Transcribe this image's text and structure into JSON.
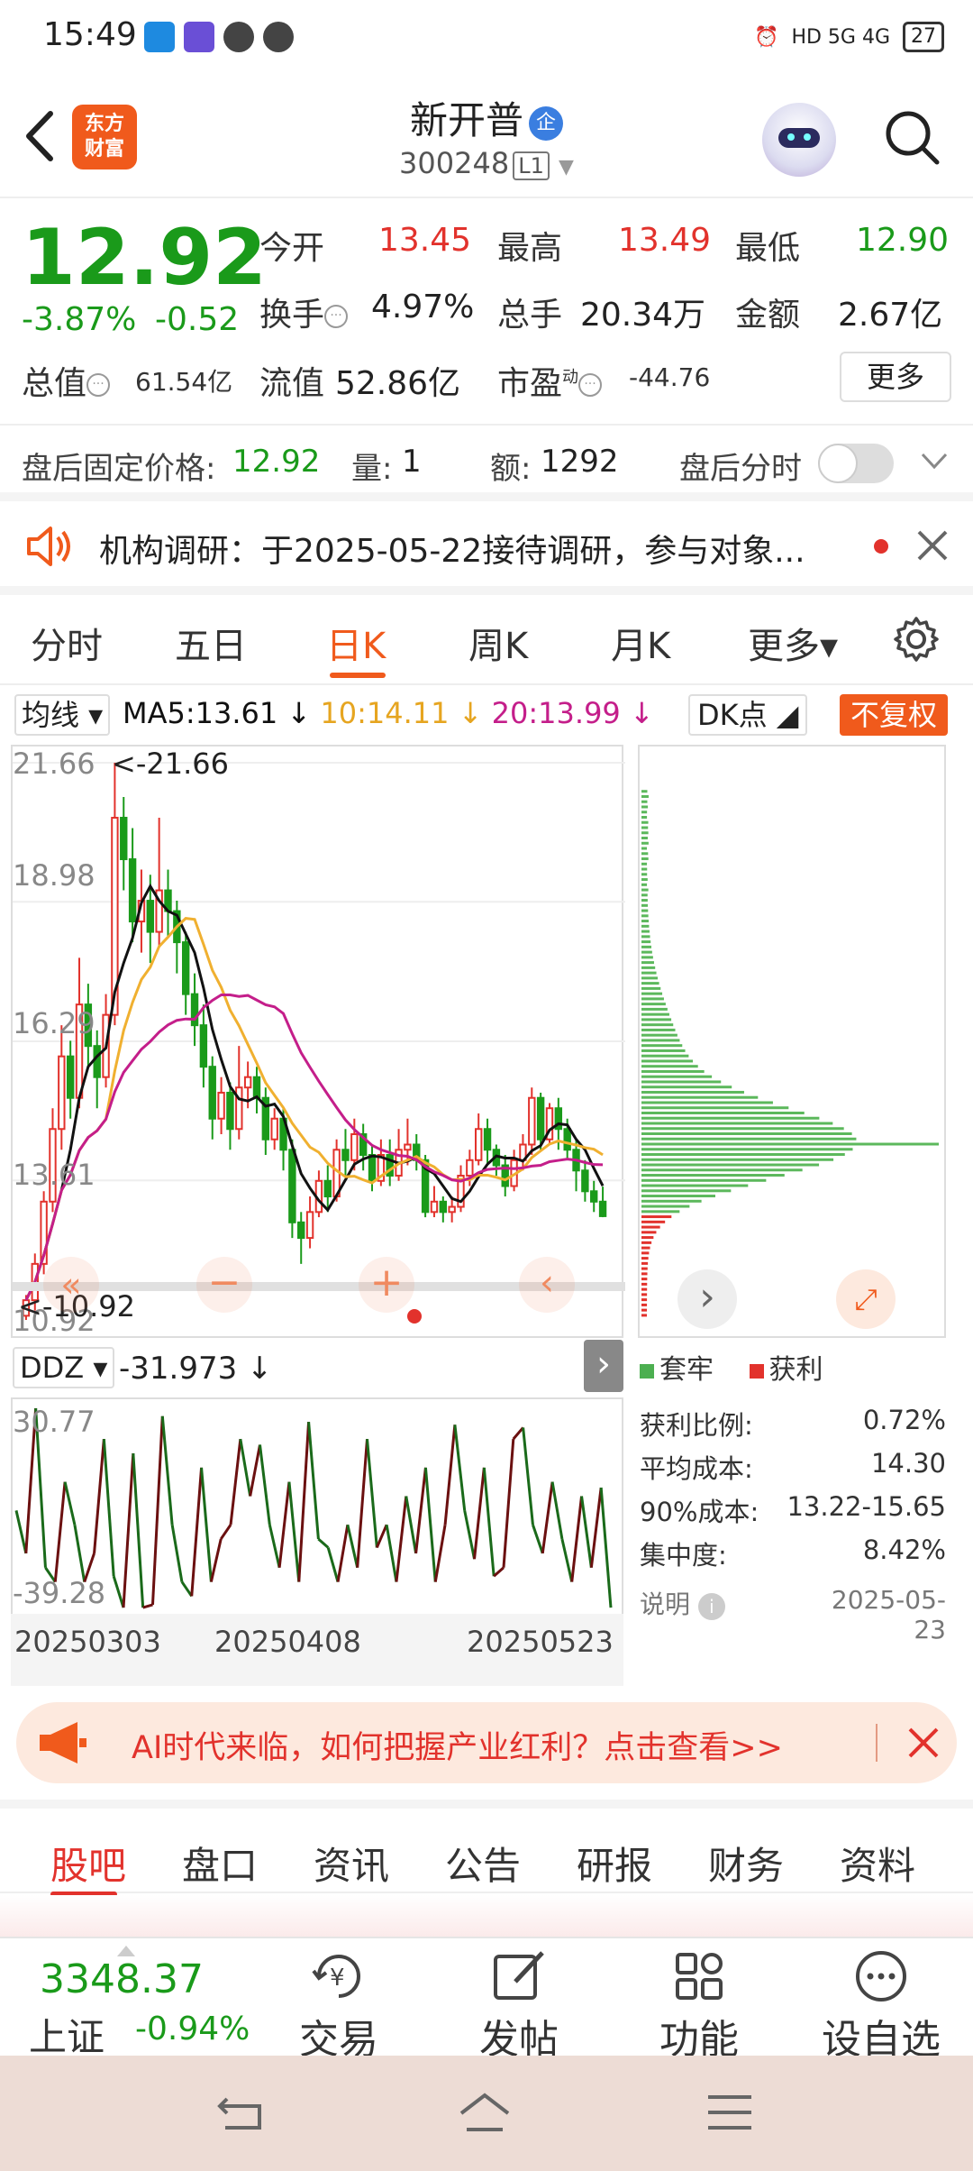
{
  "status_bar": {
    "time": "15:49",
    "network": "HD 5G 4G",
    "battery": "27"
  },
  "header": {
    "back_label": "‹",
    "logo_line1": "东方",
    "logo_line2": "财富",
    "stock_name": "新开普",
    "ent_badge": "企",
    "stock_code": "300248",
    "level": "L1"
  },
  "quote": {
    "price": "12.92",
    "change_pct": "-3.87%",
    "change_val": "-0.52",
    "open_label": "今开",
    "open": "13.45",
    "high_label": "最高",
    "high": "13.49",
    "low_label": "最低",
    "low": "12.90",
    "turnover_label": "换手",
    "turnover": "4.97%",
    "volume_label": "总手",
    "volume": "20.34万",
    "amount_label": "金额",
    "amount": "2.67亿",
    "total_cap_label": "总值",
    "total_cap": "61.54亿",
    "float_cap_label": "流值",
    "float_cap": "52.86亿",
    "pe_label": "市盈",
    "pe_sup": "动",
    "pe": "-44.76",
    "more_label": "更多"
  },
  "after_hours": {
    "price_label": "盘后固定价格:",
    "price": "12.92",
    "vol_label": "量:",
    "vol": "1",
    "amt_label": "额:",
    "amt": "1292",
    "tick_label": "盘后分时"
  },
  "notice": {
    "text": "机构调研：于2025-05-22接待调研，参与对象..."
  },
  "chart_tabs": {
    "items": [
      "分时",
      "五日",
      "日K",
      "周K",
      "月K",
      "更多▾"
    ],
    "active": 2
  },
  "ma": {
    "select": "均线 ▾",
    "ma5": "MA5:13.61 ↓",
    "ma10": "10:14.11 ↓",
    "ma20": "20:13.99 ↓",
    "dk": "DK点 ◢",
    "fq": "不复权"
  },
  "colors": {
    "up": "#e2322c",
    "down": "#1a9a1a",
    "ma5": "#111111",
    "ma10": "#f0b030",
    "ma20": "#c41e8a",
    "accent": "#f05a1c"
  },
  "kchart": {
    "axis": {
      "top": "21.66",
      "l2": "18.98",
      "l3": "16.29",
      "l4": "13.61",
      "bottom": "10.92"
    },
    "max_annot": "<-21.66",
    "min_annot": "<-10.92",
    "chart_data": {
      "type": "candlestick",
      "ylim": [
        10.92,
        21.66
      ],
      "candles": [
        [
          11.0,
          11.3,
          10.92,
          11.4
        ],
        [
          11.3,
          12.0,
          11.1,
          12.2
        ],
        [
          12.0,
          13.2,
          11.8,
          13.4
        ],
        [
          13.2,
          14.6,
          13.0,
          15.0
        ],
        [
          14.6,
          16.0,
          14.2,
          16.6
        ],
        [
          16.0,
          15.2,
          14.8,
          16.3
        ],
        [
          15.2,
          17.0,
          15.0,
          17.9
        ],
        [
          17.0,
          16.2,
          15.8,
          17.4
        ],
        [
          16.2,
          15.6,
          15.0,
          16.5
        ],
        [
          15.6,
          16.8,
          15.4,
          17.2
        ],
        [
          16.8,
          20.6,
          16.6,
          21.66
        ],
        [
          20.6,
          19.8,
          19.2,
          21.0
        ],
        [
          19.8,
          18.6,
          18.2,
          20.4
        ],
        [
          18.6,
          19.0,
          18.0,
          19.6
        ],
        [
          19.0,
          18.4,
          17.8,
          19.5
        ],
        [
          18.4,
          19.2,
          18.1,
          20.6
        ],
        [
          19.2,
          18.8,
          18.3,
          19.6
        ],
        [
          18.8,
          18.2,
          17.6,
          19.0
        ],
        [
          18.2,
          17.2,
          16.8,
          18.4
        ],
        [
          17.2,
          16.6,
          16.2,
          17.6
        ],
        [
          16.6,
          15.8,
          15.4,
          17.0
        ],
        [
          15.8,
          14.8,
          14.4,
          16.0
        ],
        [
          14.8,
          15.3,
          14.5,
          15.6
        ],
        [
          15.3,
          14.6,
          14.2,
          15.5
        ],
        [
          14.6,
          15.4,
          14.4,
          16.2
        ],
        [
          15.4,
          15.6,
          15.0,
          15.9
        ],
        [
          15.6,
          15.2,
          14.9,
          15.8
        ],
        [
          15.2,
          14.4,
          14.1,
          15.4
        ],
        [
          14.4,
          14.8,
          14.2,
          15.0
        ],
        [
          14.8,
          14.2,
          13.8,
          15.0
        ],
        [
          14.2,
          12.8,
          12.5,
          14.4
        ],
        [
          12.8,
          12.5,
          12.0,
          13.0
        ],
        [
          12.5,
          13.0,
          12.3,
          13.3
        ],
        [
          13.0,
          13.6,
          12.9,
          13.8
        ],
        [
          13.6,
          13.3,
          13.0,
          13.9
        ],
        [
          13.3,
          14.2,
          13.2,
          14.4
        ],
        [
          14.2,
          14.0,
          13.7,
          14.6
        ],
        [
          14.0,
          14.5,
          13.8,
          14.8
        ],
        [
          14.5,
          14.1,
          13.8,
          14.7
        ],
        [
          14.1,
          13.6,
          13.4,
          14.3
        ],
        [
          13.6,
          14.1,
          13.5,
          14.4
        ],
        [
          14.1,
          13.7,
          13.5,
          14.4
        ],
        [
          13.7,
          14.2,
          13.6,
          14.6
        ],
        [
          14.2,
          14.3,
          13.9,
          14.8
        ],
        [
          14.3,
          14.0,
          13.8,
          14.5
        ],
        [
          14.0,
          13.0,
          12.9,
          14.1
        ],
        [
          13.0,
          13.2,
          12.9,
          13.5
        ],
        [
          13.2,
          13.0,
          12.8,
          13.3
        ],
        [
          13.0,
          13.1,
          12.8,
          13.3
        ],
        [
          13.1,
          13.7,
          13.0,
          13.9
        ],
        [
          13.7,
          14.0,
          13.5,
          14.2
        ],
        [
          14.0,
          14.6,
          13.9,
          14.9
        ],
        [
          14.6,
          14.2,
          13.9,
          14.8
        ],
        [
          14.2,
          13.9,
          13.7,
          14.3
        ],
        [
          13.9,
          13.5,
          13.3,
          14.1
        ],
        [
          13.5,
          14.0,
          13.4,
          14.2
        ],
        [
          14.0,
          14.3,
          13.8,
          14.5
        ],
        [
          14.3,
          15.2,
          14.1,
          15.4
        ],
        [
          15.2,
          14.4,
          14.2,
          15.3
        ],
        [
          14.4,
          15.0,
          14.3,
          15.1
        ],
        [
          15.0,
          14.6,
          14.2,
          15.2
        ],
        [
          14.6,
          14.2,
          14.0,
          14.8
        ],
        [
          14.2,
          13.8,
          13.4,
          14.4
        ],
        [
          13.8,
          13.4,
          13.2,
          14.0
        ],
        [
          13.4,
          13.2,
          13.0,
          13.6
        ],
        [
          13.2,
          12.92,
          12.9,
          13.49
        ]
      ]
    }
  },
  "chip": {
    "legend_trapped": "套牢",
    "legend_profit": "获利",
    "stats": [
      {
        "label": "获利比例:",
        "value": "0.72%"
      },
      {
        "label": "平均成本:",
        "value": "14.30"
      },
      {
        "label": "90%成本:",
        "value": "13.22-15.65"
      },
      {
        "label": "集中度:",
        "value": "8.42%"
      }
    ],
    "note": "说明",
    "date": "2025-05-23",
    "chart_data": {
      "type": "bar",
      "orientation": "horizontal",
      "ylim": [
        10.92,
        21.66
      ],
      "peak_price": 14.3
    }
  },
  "ddz": {
    "select": "DDZ ▾",
    "value": "-31.973 ↓",
    "top": "30.77",
    "bottom": "-39.28",
    "chart_data": {
      "type": "line",
      "ylim": [
        -39.28,
        30.77
      ],
      "values": [
        -5,
        -20,
        30.77,
        -25,
        -30,
        5,
        -10,
        -30,
        -20,
        20,
        -28,
        -39,
        15,
        -39,
        -38,
        28,
        -10,
        -30,
        -35,
        10,
        -30,
        -15,
        -10,
        20,
        0,
        18,
        -10,
        -25,
        5,
        -30,
        26,
        -15,
        -18,
        -30,
        -10,
        -25,
        20,
        -18,
        -10,
        -30,
        0,
        -20,
        10,
        -30,
        -10,
        25,
        -5,
        -22,
        10,
        -28,
        -25,
        20,
        24,
        -10,
        -20,
        5,
        -15,
        -30,
        0,
        -25,
        3,
        -39
      ]
    }
  },
  "dates": {
    "d1": "20250303",
    "d2": "20250408",
    "d3": "20250523"
  },
  "ad": {
    "text": "AI时代来临，如何把握产业红利？点击查看>>"
  },
  "section_tabs": {
    "items": [
      "股吧",
      "盘口",
      "资讯",
      "公告",
      "研报",
      "财务",
      "资料"
    ],
    "active": 0
  },
  "bottom_bar": {
    "index_val": "3348.37",
    "index_name": "上证",
    "index_chg": "-0.94%",
    "trade": "交易",
    "post": "发帖",
    "func": "功能",
    "watch": "设自选"
  }
}
